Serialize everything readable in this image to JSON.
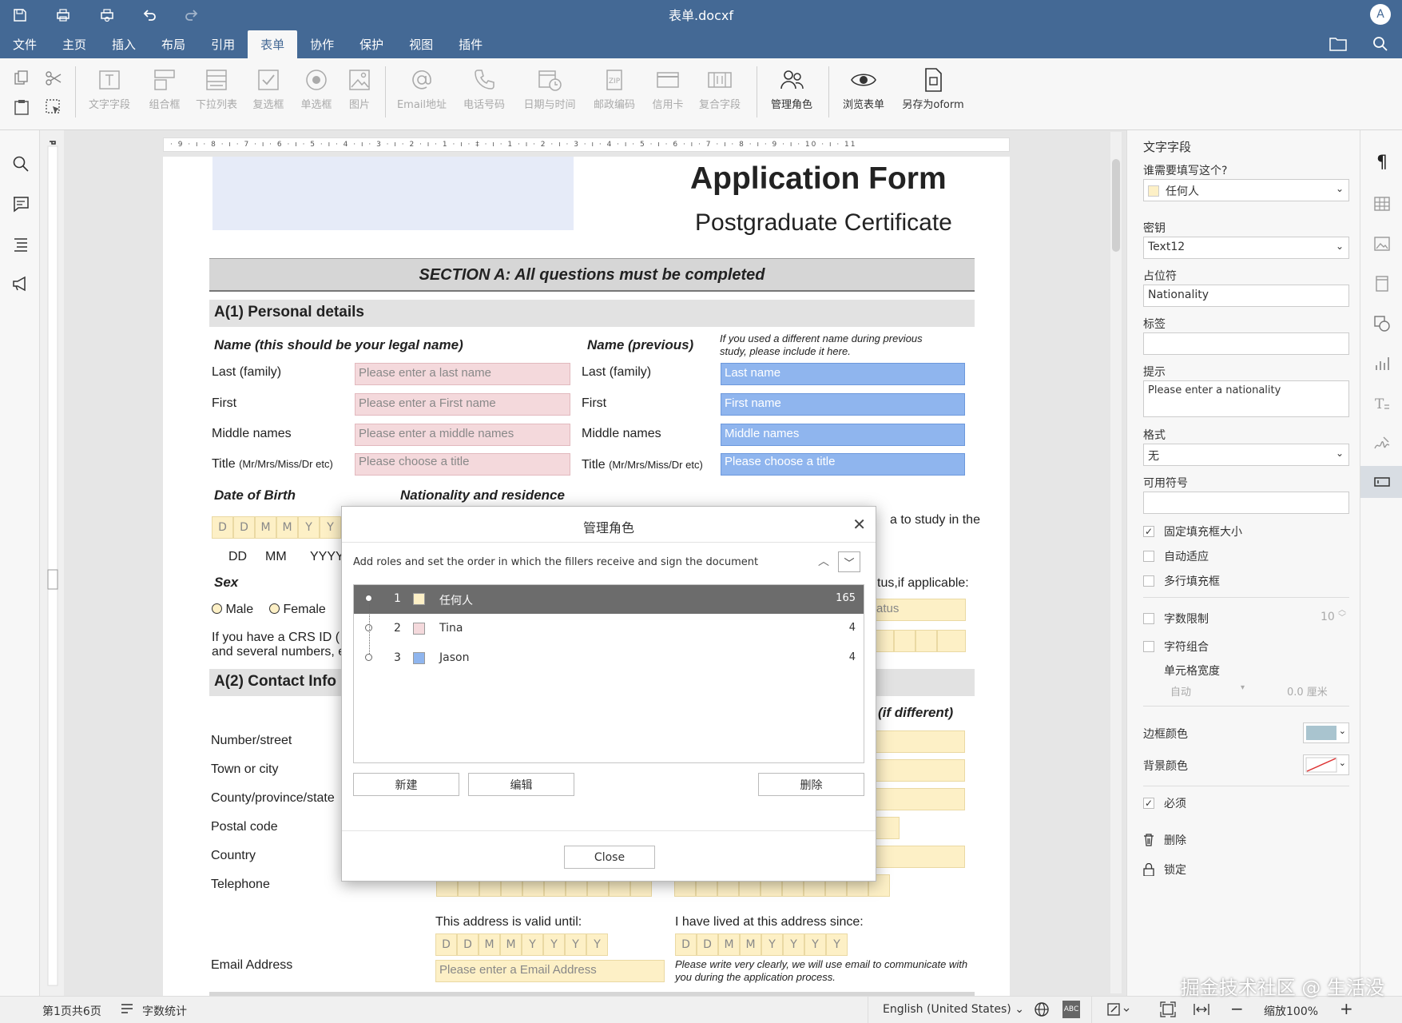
{
  "window": {
    "title": "表单.docxf",
    "avatar_letter": "A"
  },
  "menu": [
    "文件",
    "主页",
    "插入",
    "布局",
    "引用",
    "表单",
    "协作",
    "保护",
    "视图",
    "插件"
  ],
  "toolbar": {
    "buttons": [
      {
        "label": "文字字段",
        "icon": "text-field-icon"
      },
      {
        "label": "组合框",
        "icon": "combo-box-icon"
      },
      {
        "label": "下拉列表",
        "icon": "dropdown-list-icon"
      },
      {
        "label": "复选框",
        "icon": "checkbox-icon"
      },
      {
        "label": "单选框",
        "icon": "radio-icon"
      },
      {
        "label": "图片",
        "icon": "image-icon"
      },
      {
        "label": "Email地址",
        "icon": "at-icon"
      },
      {
        "label": "电话号码",
        "icon": "phone-icon"
      },
      {
        "label": "日期与时间",
        "icon": "datetime-icon"
      },
      {
        "label": "邮政编码",
        "icon": "zip-icon"
      },
      {
        "label": "信用卡",
        "icon": "credit-card-icon"
      },
      {
        "label": "复合字段",
        "icon": "complex-field-icon"
      },
      {
        "label": "管理角色",
        "icon": "roles-icon"
      },
      {
        "label": "浏览表单",
        "icon": "eye-icon"
      },
      {
        "label": "另存为oform",
        "icon": "save-oform-icon"
      }
    ]
  },
  "ruler": {
    "ticks": "· 9 · ı · 8 · ı · 7 · ı · 6 · ı · 5 · ı · 4 · ı · 3 · ı · 2 · ı · 1 · ı · ‡ · ı · 1 · ı · 2 · ı · 3 · ı · 4 · ı · 5 · ı · 6 · ı · 7 · ı · 8 · ı · 9 · ı · 10 · ı · 11"
  },
  "document": {
    "title": "Application Form",
    "subtitle": "Postgraduate Certificate",
    "section_a": "SECTION A: All questions must be completed",
    "a1": "A(1) Personal details",
    "name_legal": "Name (this should be your legal name)",
    "name_previous": "Name (previous)",
    "name_previous_note": "If you used a different name during previous study, please include it here.",
    "last": "Last (family)",
    "first": "First",
    "middle": "Middle names",
    "title_label": "Title",
    "title_hint": "(Mr/Mrs/Miss/Dr etc)",
    "ph_last": "Please enter a last name",
    "ph_first": "Please enter a First name",
    "ph_middle": "Please enter a middle names",
    "ph_title": "Please choose a title",
    "ph_last_prev": "Last name",
    "ph_first_prev": "First name",
    "ph_middle_prev": "Middle names",
    "ph_title_prev": "Please choose a title",
    "dob": "Date of Birth",
    "nationality": "Nationality and residence",
    "date_boxes": [
      "D",
      "D",
      "M",
      "M",
      "Y",
      "Y"
    ],
    "date_boxes_full": [
      "D",
      "D",
      "M",
      "M",
      "Y",
      "Y",
      "Y",
      "Y"
    ],
    "dd": "DD",
    "mm": "MM",
    "yyyy": "YYYY",
    "visa_text": "a to study in the",
    "status_text": "tus,if applicable:",
    "status_field": "atus",
    "sex": "Sex",
    "male": "Male",
    "female": "Female",
    "crs_line1": "If you have a CRS ID (",
    "crs_line2": "and several numbers, e",
    "a2": "A(2) Contact Info",
    "if_different": "(if different)",
    "number_street": "Number/street",
    "town": "Town or city",
    "county": "County/province/state",
    "postal": "Postal code",
    "country": "Country",
    "telephone": "Telephone",
    "valid_until": "This address is valid until:",
    "lived_since": "I have lived at this address since:",
    "email_label": "Email Address",
    "ph_email": "Please enter a Email Address",
    "email_note": "Please write very clearly, we will use email to communicate with you during the application process."
  },
  "dialog": {
    "title": "管理角色",
    "description": "Add roles and set the order in which the fillers receive and sign the document",
    "roles": [
      {
        "num": "1",
        "name": "任何人",
        "count": "165",
        "color": "#fdf0c6"
      },
      {
        "num": "2",
        "name": "Tina",
        "count": "4",
        "color": "#f4d9dc"
      },
      {
        "num": "3",
        "name": "Jason",
        "count": "4",
        "color": "#8fb5ee"
      }
    ],
    "new_label": "新建",
    "edit_label": "编辑",
    "delete_label": "删除",
    "close_label": "Close"
  },
  "panel": {
    "heading": "文字字段",
    "who_fills": "谁需要填写这个?",
    "who_value": "任何人",
    "key_label": "密钥",
    "key_value": "Text12",
    "placeholder_label": "占位符",
    "placeholder_value": "Nationality",
    "tag_label": "标签",
    "tag_value": "",
    "tip_label": "提示",
    "tip_value": "Please enter a nationality",
    "format_label": "格式",
    "format_value": "无",
    "allowed_label": "可用符号",
    "allowed_value": "",
    "fixed_size": "固定填充框大小",
    "autofit": "自动适应",
    "multiline": "多行填充框",
    "char_limit": "字数限制",
    "char_limit_value": "10",
    "comb": "字符组合",
    "cell_width": "单元格宽度",
    "cell_width_mode": "自动",
    "cell_width_value": "0.0 厘米",
    "border_color": "边框颜色",
    "border_color_hex": "#a9c4cf",
    "bg_color": "背景颜色",
    "required": "必须",
    "delete": "删除",
    "lock": "锁定"
  },
  "status": {
    "page": "第1页共6页",
    "word_count": "字数统计",
    "language": "English (United States)",
    "zoom": "缩放100%"
  },
  "watermark": "掘金技术社区 @ 生活没"
}
